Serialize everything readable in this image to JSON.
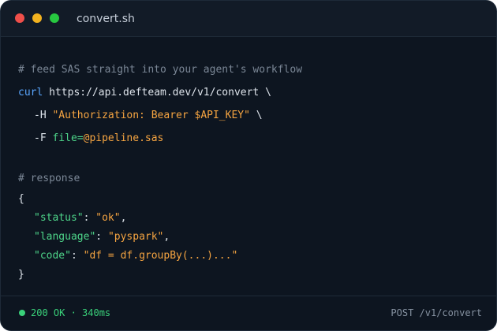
{
  "window": {
    "title": "convert.sh"
  },
  "request": {
    "comment": "# feed SAS straight into your agent's workflow",
    "command": "curl",
    "url": " https://api.defteam.dev/v1/convert \\",
    "header_flag": "-H ",
    "header_value": "\"Authorization: Bearer $API_KEY\"",
    "header_tail": " \\",
    "file_flag": "-F ",
    "file_key": "file=",
    "file_value": "@pipeline.sas"
  },
  "response": {
    "comment": "# response",
    "open_brace": "{",
    "close_brace": "}",
    "fields": [
      {
        "key": "\"status\"",
        "sep": ": ",
        "value": "\"ok\"",
        "tail": ","
      },
      {
        "key": "\"language\"",
        "sep": ": ",
        "value": "\"pyspark\"",
        "tail": ","
      },
      {
        "key": "\"code\"",
        "sep": ": ",
        "value": "\"df = df.groupBy(...)...\"",
        "tail": ""
      }
    ]
  },
  "status": {
    "text": "200 OK · 340ms",
    "endpoint": "POST /v1/convert"
  },
  "colors": {
    "background": "#0d1520",
    "comment": "#7b8796",
    "keyword": "#5aa7ff",
    "string": "#f5a441",
    "json_key": "#4ed68a",
    "status_ok": "#3ad17a"
  }
}
